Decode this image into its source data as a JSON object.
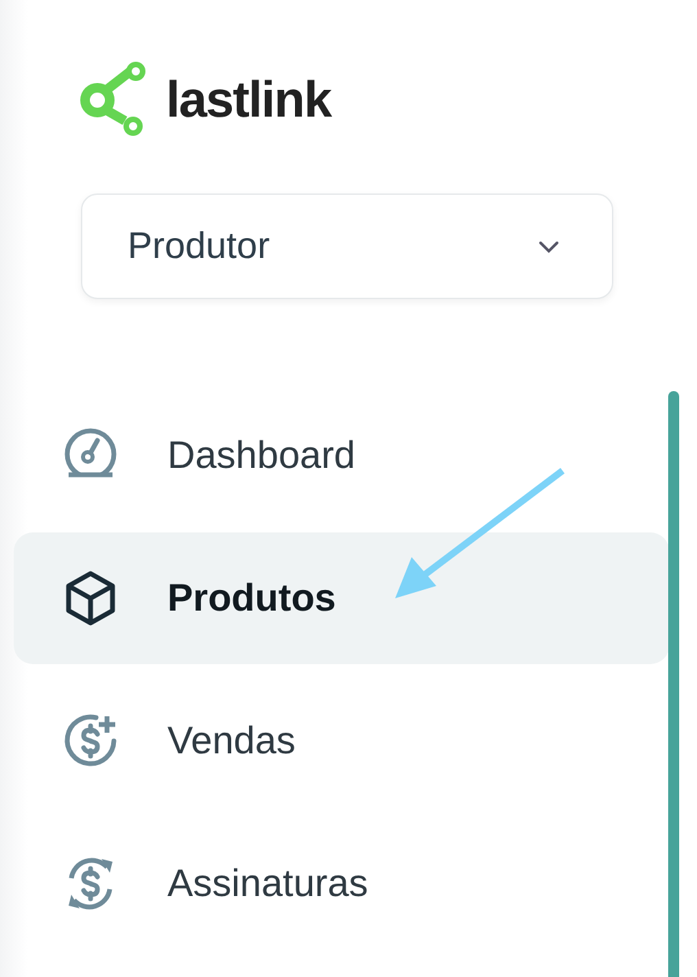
{
  "logo": {
    "text": "lastlink"
  },
  "role_select": {
    "value": "Produtor"
  },
  "nav": {
    "items": [
      {
        "label": "Dashboard",
        "kind": "gauge",
        "selected": false
      },
      {
        "label": "Produtos",
        "kind": "box",
        "selected": true
      },
      {
        "label": "Vendas",
        "kind": "dollar-plus",
        "selected": false
      },
      {
        "label": "Assinaturas",
        "kind": "dollar-cycle",
        "selected": false
      }
    ]
  }
}
